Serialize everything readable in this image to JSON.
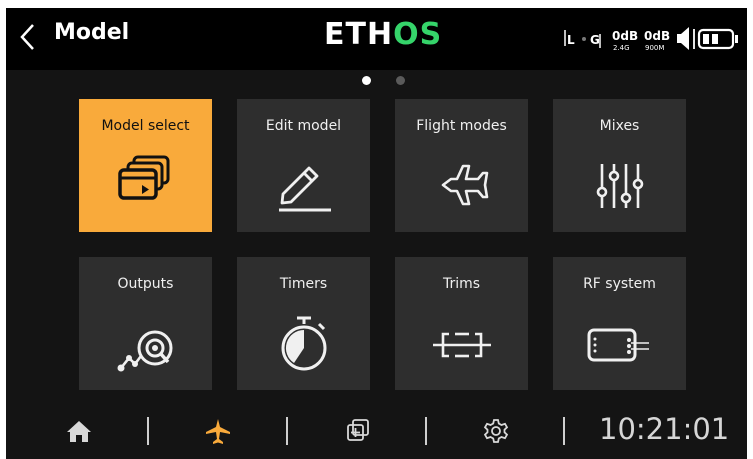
{
  "header": {
    "title": "Model",
    "logo_main": "ETH",
    "logo_accent": "OS"
  },
  "status": {
    "rssi_2g4": "0dB",
    "rssi_900m": "0dB",
    "band_2g4": "2.4G",
    "band_900m": "900M",
    "flag_l": "L",
    "flag_g": "G"
  },
  "pager": {
    "pages": 2,
    "current": 1
  },
  "tiles": [
    {
      "label": "Model select",
      "icon": "model-select-icon"
    },
    {
      "label": "Edit model",
      "icon": "pencil-icon"
    },
    {
      "label": "Flight modes",
      "icon": "airplane-icon"
    },
    {
      "label": "Mixes",
      "icon": "sliders-icon"
    },
    {
      "label": "Outputs",
      "icon": "outputs-icon"
    },
    {
      "label": "Timers",
      "icon": "stopwatch-icon"
    },
    {
      "label": "Trims",
      "icon": "trims-icon"
    },
    {
      "label": "RF system",
      "icon": "rf-module-icon"
    }
  ],
  "bottom": {
    "time": "10:21:01",
    "icons": [
      "home-icon",
      "airplane-icon",
      "system-icon",
      "settings-icon"
    ]
  },
  "colors": {
    "accent": "#f9aa3b",
    "tile": "#2e2e2e",
    "background": "#141414",
    "logo_green": "#35d46a"
  }
}
